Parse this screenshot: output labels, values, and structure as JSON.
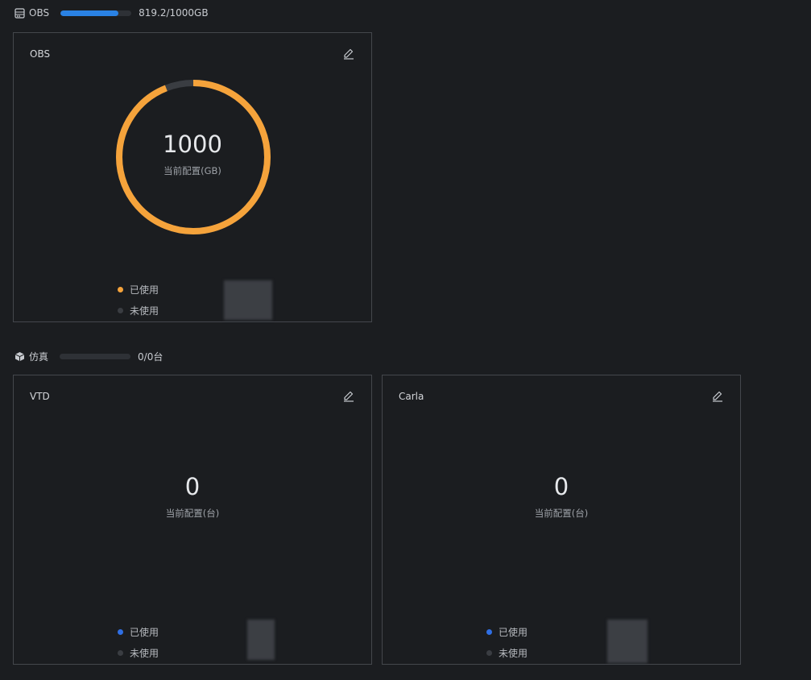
{
  "colors": {
    "used_orange": "#f5a33b",
    "used_blue": "#2f6fe4",
    "unused_gray": "#3a3d42",
    "progress_blue": "#2a82e4"
  },
  "storage": {
    "header_title": "OBS",
    "header_icon": "database-icon",
    "progress_text": "819.2/1000GB",
    "progress_fraction": 0.819,
    "card": {
      "title": "OBS",
      "value": "1000",
      "label": "当前配置(GB)",
      "used_fraction": 0.94,
      "legend_used": "已使用",
      "legend_unused": "未使用"
    }
  },
  "simulation": {
    "header_title": "仿真",
    "header_icon": "cube-icon",
    "progress_text": "0/0台",
    "progress_fraction": 0,
    "cards": [
      {
        "title": "VTD",
        "value": "0",
        "label": "当前配置(台)",
        "legend_used": "已使用",
        "legend_unused": "未使用"
      },
      {
        "title": "Carla",
        "value": "0",
        "label": "当前配置(台)",
        "legend_used": "已使用",
        "legend_unused": "未使用"
      }
    ]
  }
}
